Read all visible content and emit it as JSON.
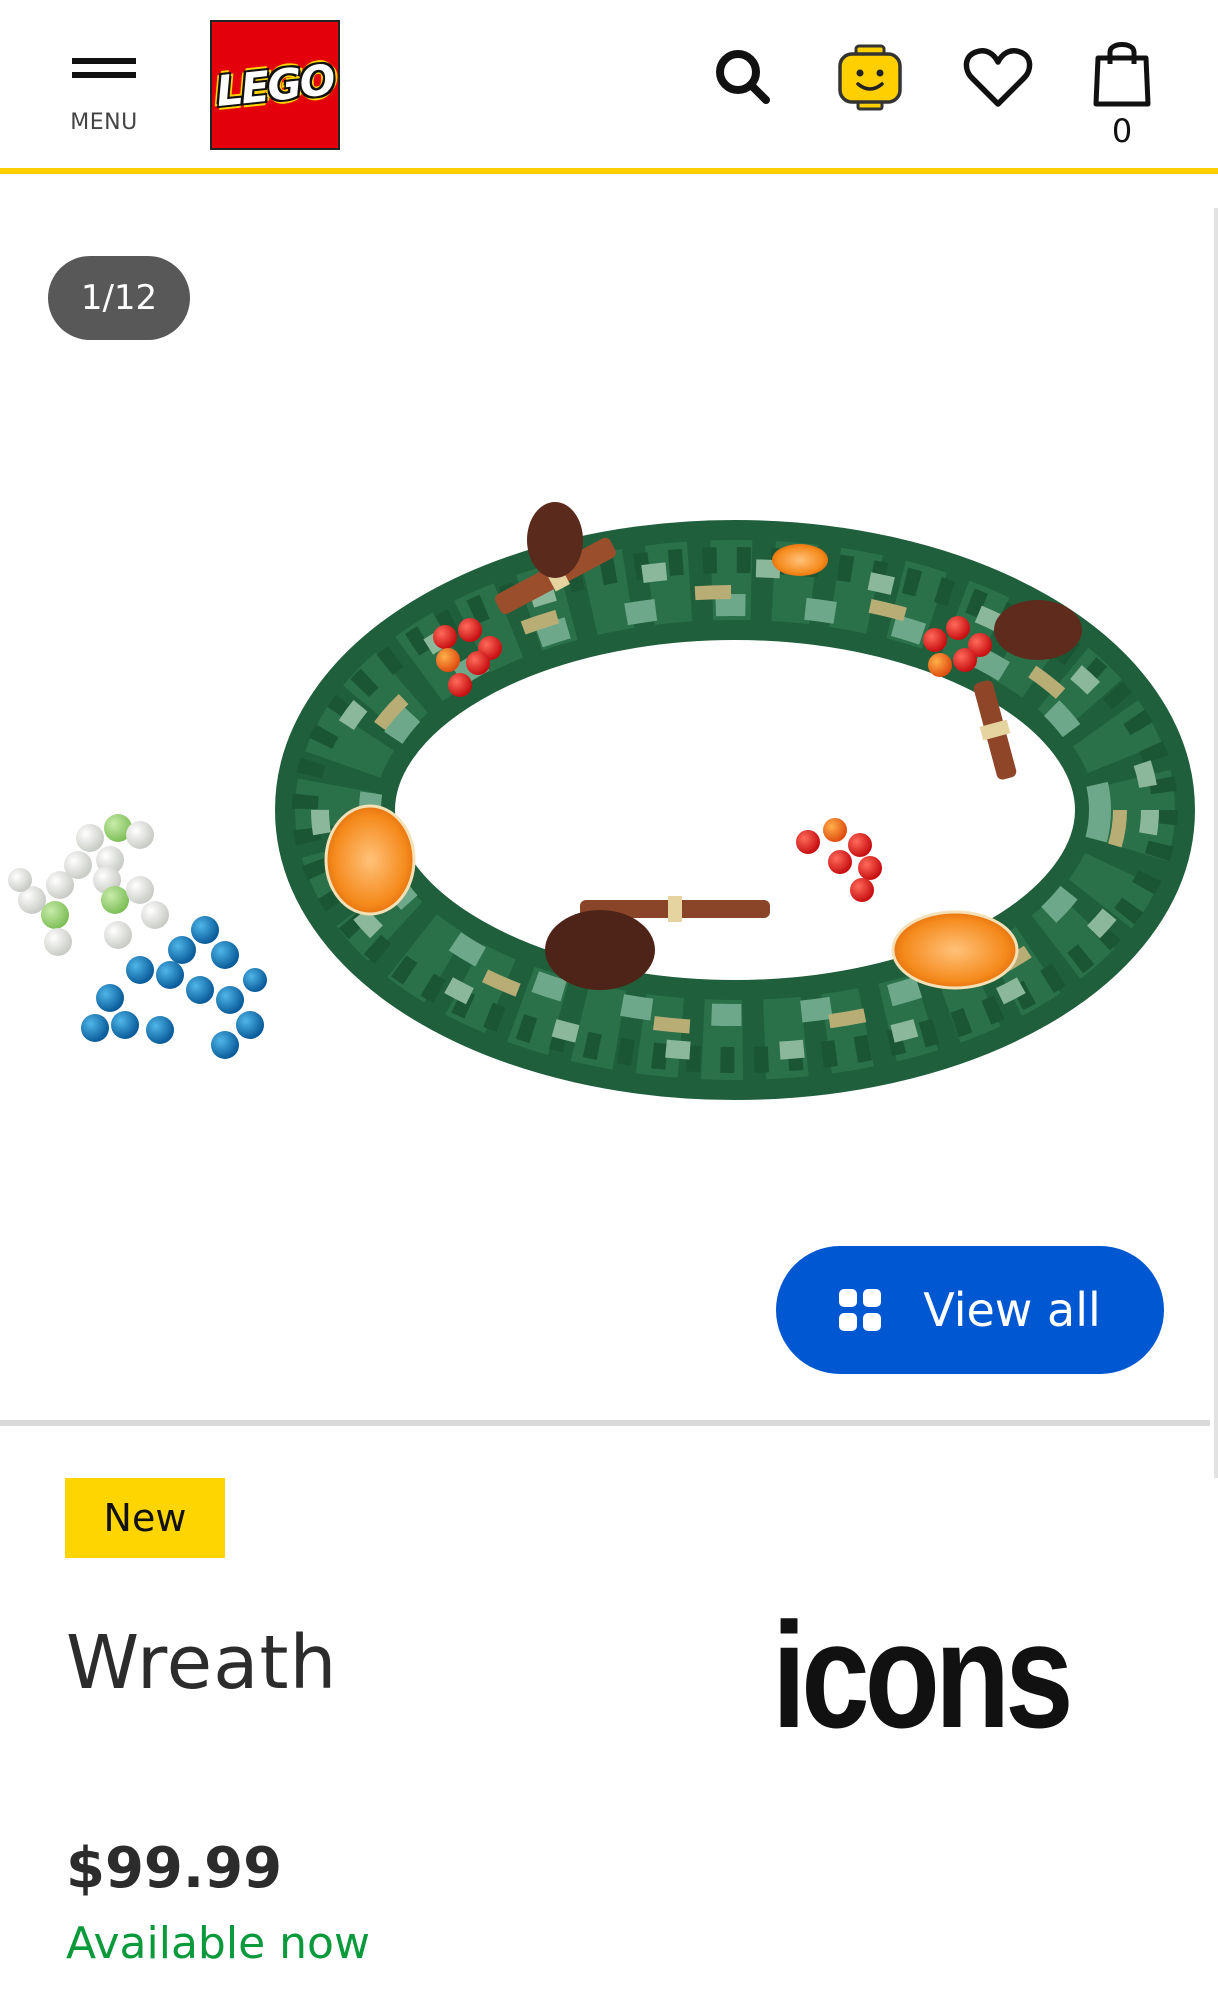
{
  "header": {
    "menu_label": "MENU",
    "logo_text": "LEGO",
    "bag_count": "0",
    "icons": [
      "menu-icon",
      "lego-logo",
      "search-icon",
      "account-minifig-head-icon",
      "heart-icon",
      "shopping-bag-icon"
    ]
  },
  "gallery": {
    "counter": "1/12",
    "view_all_label": "View all",
    "view_all_icon": "grid-icon",
    "image_alt": "LEGO Wreath set with pine branches, holly berries, cinnamon sticks, orange slices, pine cones and extra berry pieces"
  },
  "product": {
    "badge": "New",
    "title": "Wreath",
    "theme_logo_text": "icons",
    "price": "$99.99",
    "availability": "Available now"
  },
  "colors": {
    "header_accent": "#ffcf00",
    "logo_red": "#e3000b",
    "button_blue": "#0057d2",
    "badge_yellow": "#ffd500",
    "available_green": "#0a9a3c",
    "counter_bg": "#585858"
  }
}
